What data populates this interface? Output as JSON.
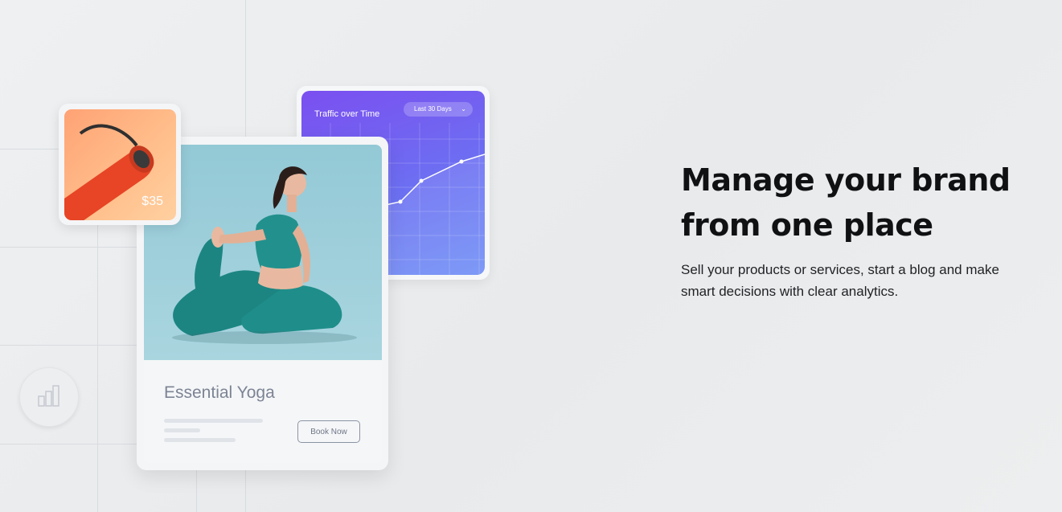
{
  "hero": {
    "headline": "Manage your brand from one place",
    "subtext": "Sell your products or services, start a blog and make smart decisions with clear analytics."
  },
  "traffic_card": {
    "title": "Traffic over Time",
    "range_select": "Last 30 Days",
    "range_icon": "chevron-down-icon"
  },
  "product_card": {
    "title": "Essential Yoga",
    "button_label": "Book Now"
  },
  "price_card": {
    "price": "$35"
  },
  "icons": {
    "stats": "bar-chart-icon"
  },
  "colors": {
    "traffic_gradient_start": "#7b4ff0",
    "traffic_gradient_end": "#6f8ff5",
    "mat_orange": "#ffa274",
    "yoga_outfit": "#1f8a86",
    "photo_bg": "#93c9d6"
  }
}
